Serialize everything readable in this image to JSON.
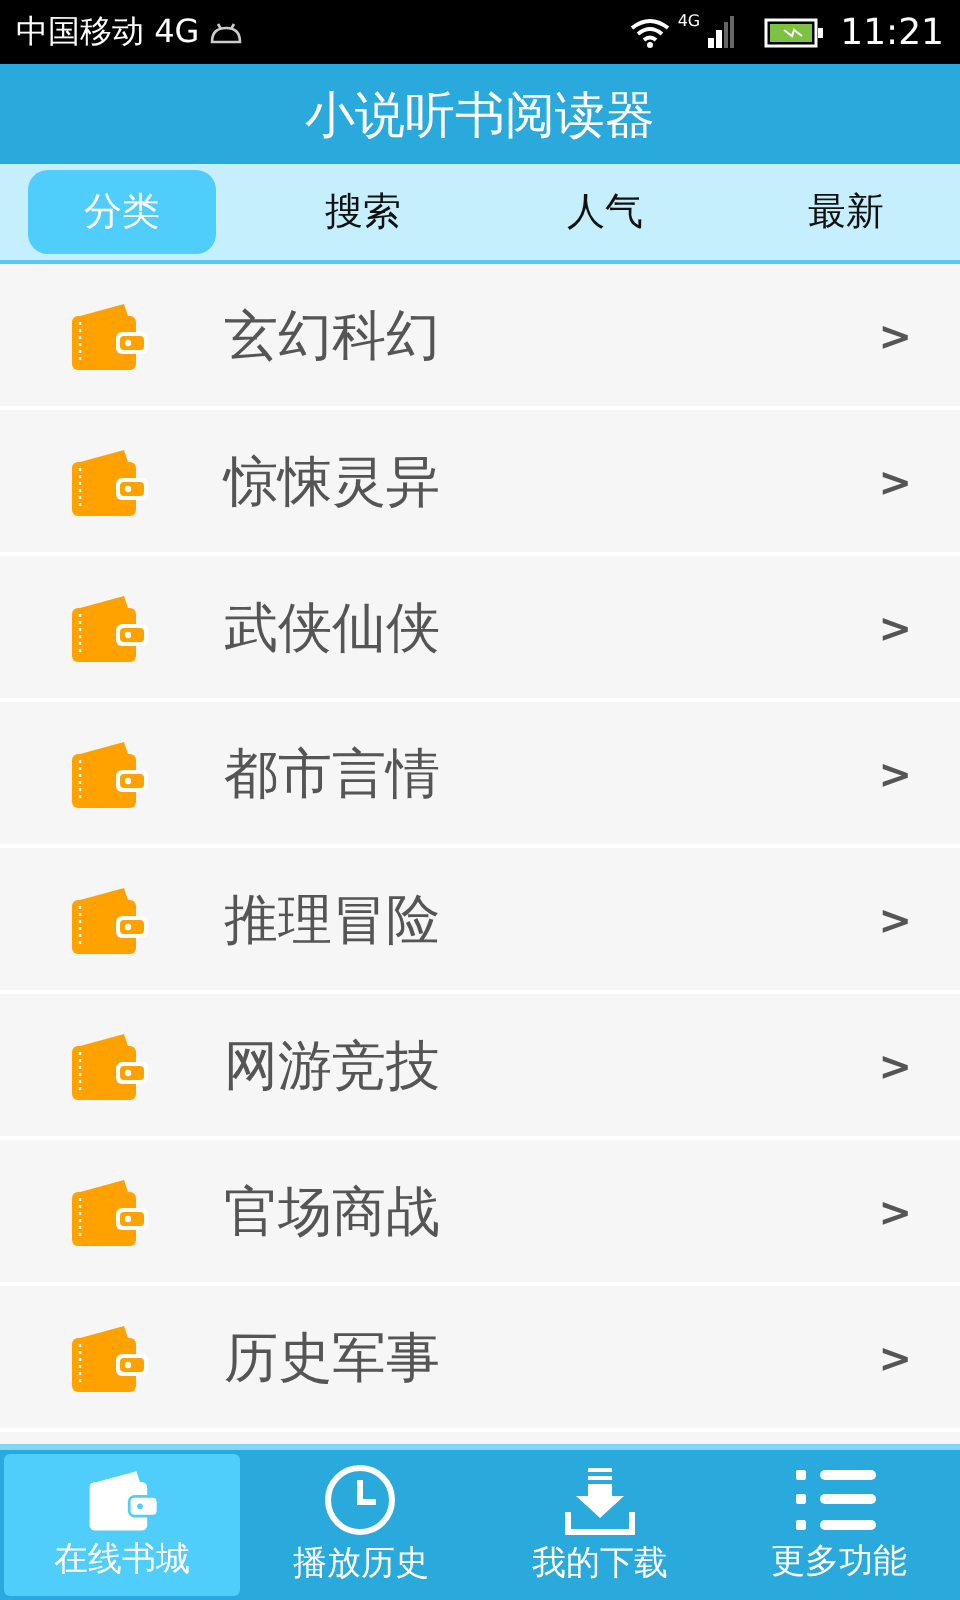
{
  "status_bar": {
    "carrier": "中国移动 4G",
    "network": "4G",
    "time": "11:21"
  },
  "header": {
    "title": "小说听书阅读器"
  },
  "tabs": [
    {
      "label": "分类",
      "selected": true
    },
    {
      "label": "搜索",
      "selected": false
    },
    {
      "label": "人气",
      "selected": false
    },
    {
      "label": "最新",
      "selected": false
    }
  ],
  "categories": [
    {
      "label": "玄幻科幻",
      "chevron": ">"
    },
    {
      "label": "惊悚灵异",
      "chevron": ">"
    },
    {
      "label": "武侠仙侠",
      "chevron": ">"
    },
    {
      "label": "都市言情",
      "chevron": ">"
    },
    {
      "label": "推理冒险",
      "chevron": ">"
    },
    {
      "label": "网游竞技",
      "chevron": ">"
    },
    {
      "label": "官场商战",
      "chevron": ">"
    },
    {
      "label": "历史军事",
      "chevron": ">"
    }
  ],
  "bottom_nav": [
    {
      "label": "在线书城",
      "kind": "wallet",
      "selected": true
    },
    {
      "label": "播放历史",
      "kind": "clock",
      "selected": false
    },
    {
      "label": "我的下载",
      "kind": "download",
      "selected": false
    },
    {
      "label": "更多功能",
      "kind": "menu",
      "selected": false
    }
  ]
}
